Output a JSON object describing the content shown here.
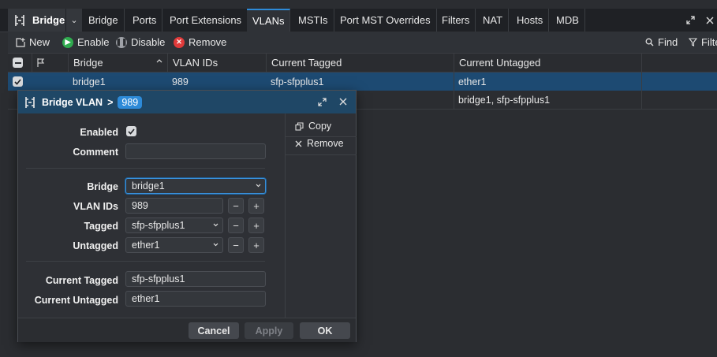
{
  "tabbar": {
    "title": "Bridge",
    "tabs": [
      {
        "label": "Bridge"
      },
      {
        "label": "Ports"
      },
      {
        "label": "Port Extensions"
      },
      {
        "label": "VLANs"
      },
      {
        "label": "MSTIs"
      },
      {
        "label": "Port MST Overrides"
      },
      {
        "label": "Filters"
      },
      {
        "label": "NAT"
      },
      {
        "label": "Hosts"
      },
      {
        "label": "MDB"
      }
    ],
    "active_tab": "VLANs"
  },
  "toolbar": {
    "new_label": "New",
    "enable_label": "Enable",
    "disable_label": "Disable",
    "remove_label": "Remove",
    "find_label": "Find",
    "filter_label": "Filte"
  },
  "table": {
    "columns": [
      "Bridge",
      "VLAN IDs",
      "Current Tagged",
      "Current Untagged"
    ],
    "rows": [
      {
        "bridge": "bridge1",
        "vlan_ids": "989",
        "current_tagged": "sfp-sfpplus1",
        "current_untagged": "ether1",
        "selected": true
      },
      {
        "bridge": "",
        "vlan_ids": "",
        "current_tagged": "",
        "current_untagged": "bridge1, sfp-sfpplus1",
        "selected": false
      }
    ]
  },
  "dialog": {
    "title": "Bridge VLAN",
    "separator": ">",
    "badge": "989",
    "fields": {
      "enabled_label": "Enabled",
      "enabled": true,
      "comment_label": "Comment",
      "comment_value": "",
      "bridge_label": "Bridge",
      "bridge_value": "bridge1",
      "vlan_ids_label": "VLAN IDs",
      "vlan_ids_value": "989",
      "tagged_label": "Tagged",
      "tagged_value": "sfp-sfpplus1",
      "untagged_label": "Untagged",
      "untagged_value": "ether1",
      "current_tagged_label": "Current Tagged",
      "current_tagged_value": "sfp-sfpplus1",
      "current_untagged_label": "Current Untagged",
      "current_untagged_value": "ether1"
    },
    "side": {
      "copy_label": "Copy",
      "remove_label": "Remove"
    },
    "footer": {
      "cancel_label": "Cancel",
      "apply_label": "Apply",
      "ok_label": "OK"
    }
  },
  "colors": {
    "accent": "#2d8ad8",
    "selected_row": "#1d4a72",
    "dialog_title_bg": "#1f4766",
    "enable_green": "#2faa4e",
    "remove_red": "#e03a3a"
  }
}
